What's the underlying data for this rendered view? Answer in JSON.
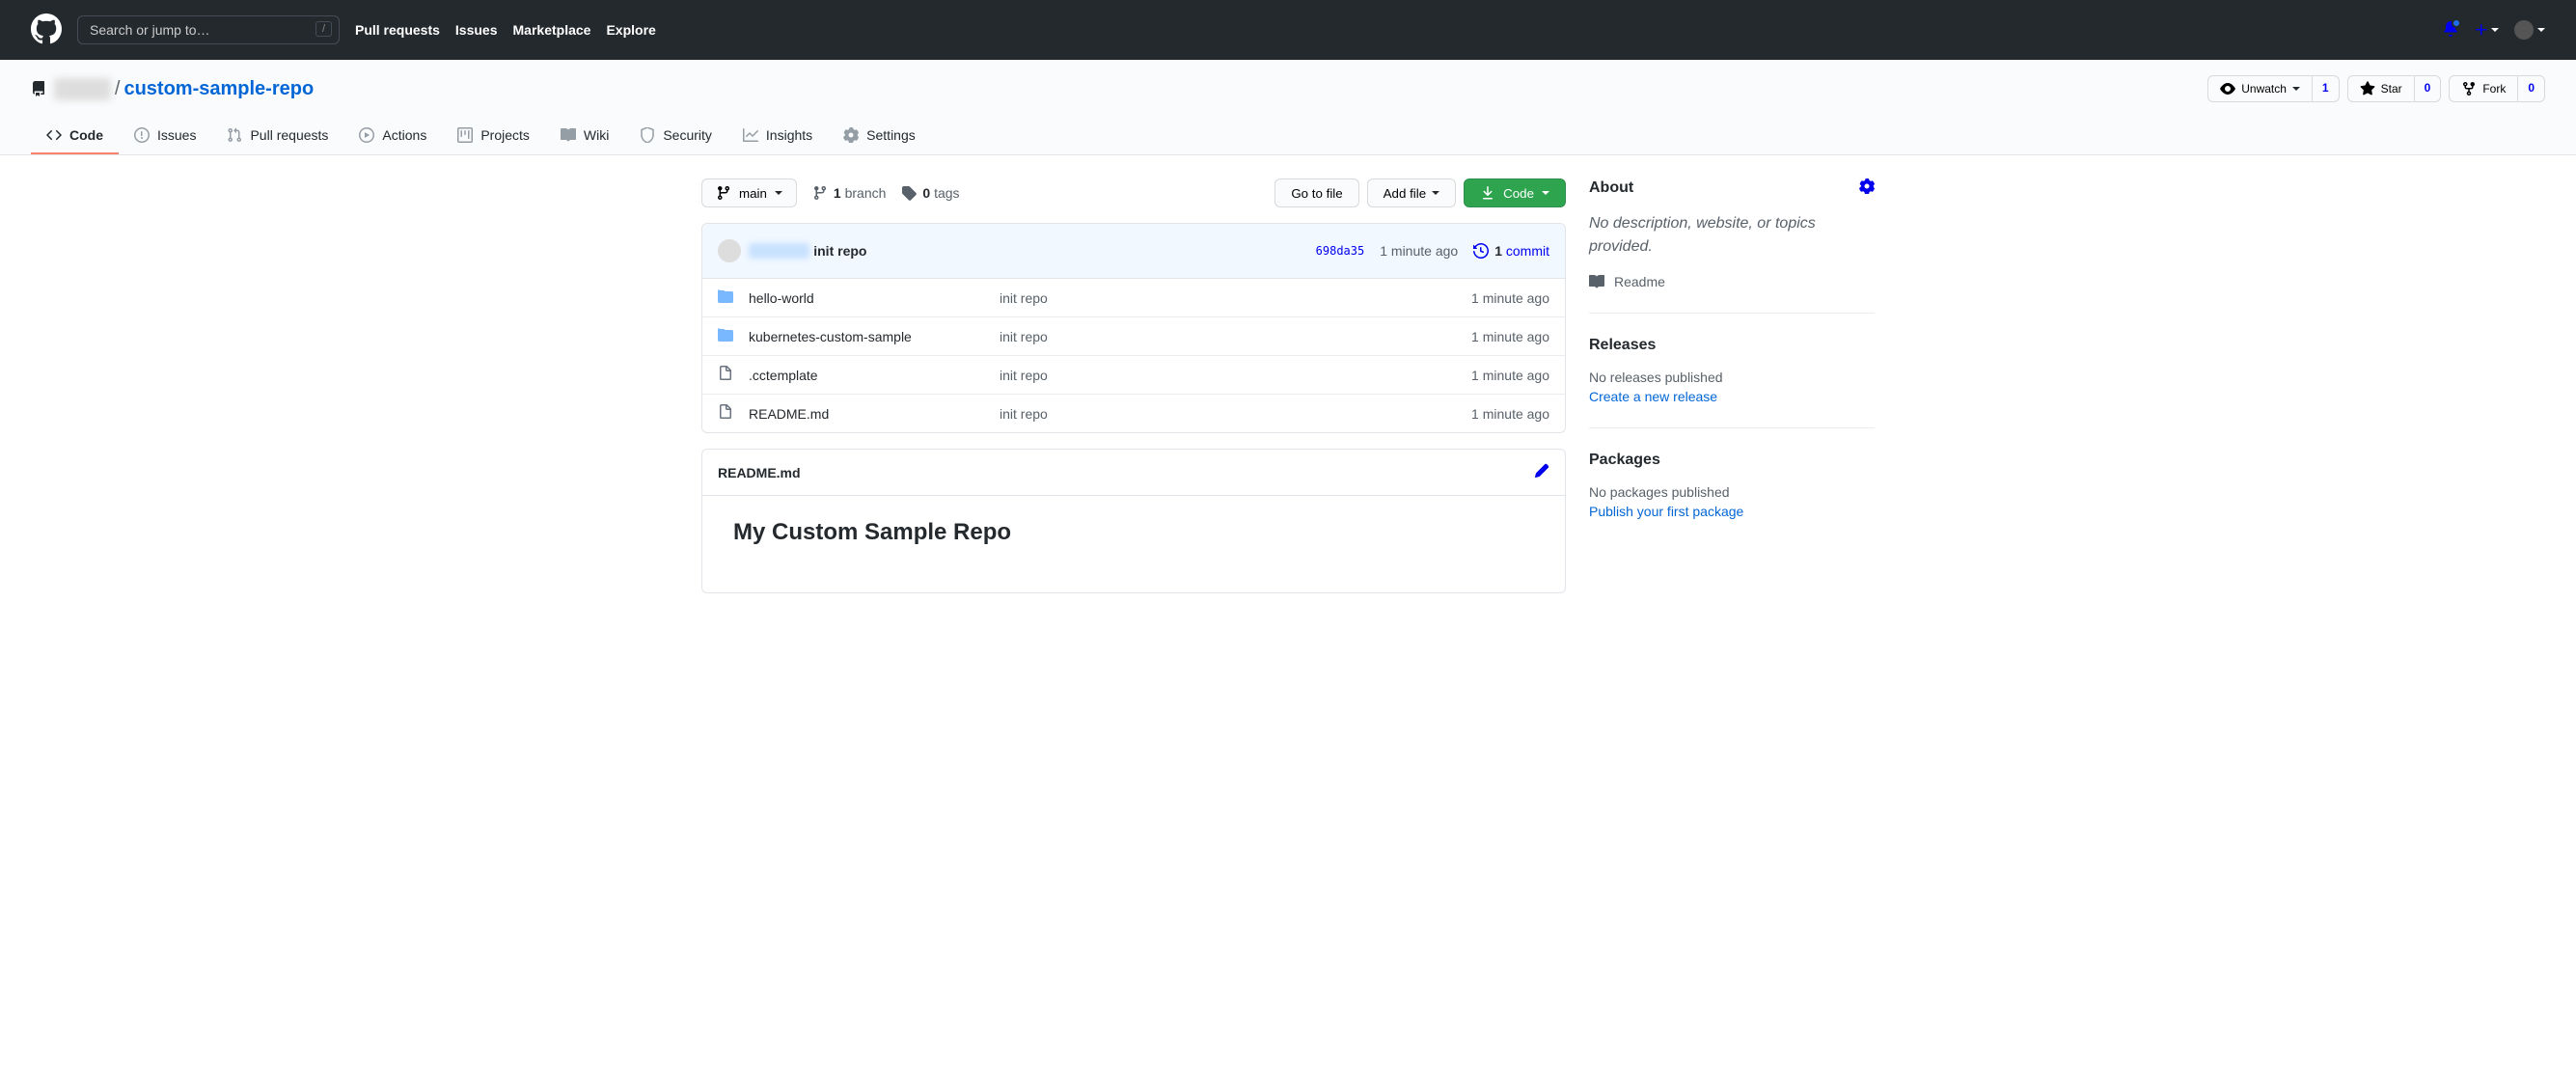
{
  "header": {
    "search_placeholder": "Search or jump to…",
    "slash_key": "/",
    "nav": {
      "pull_requests": "Pull requests",
      "issues": "Issues",
      "marketplace": "Marketplace",
      "explore": "Explore"
    }
  },
  "repo": {
    "owner": "user",
    "name": "custom-sample-repo",
    "actions": {
      "watch": {
        "label": "Unwatch",
        "count": "1"
      },
      "star": {
        "label": "Star",
        "count": "0"
      },
      "fork": {
        "label": "Fork",
        "count": "0"
      }
    }
  },
  "reponav": {
    "code": "Code",
    "issues": "Issues",
    "pulls": "Pull requests",
    "actions": "Actions",
    "projects": "Projects",
    "wiki": "Wiki",
    "security": "Security",
    "insights": "Insights",
    "settings": "Settings"
  },
  "filenav": {
    "branch": "main",
    "branch_count": "1",
    "branch_label": "branch",
    "tag_count": "0",
    "tag_label": "tags",
    "go_to_file": "Go to file",
    "add_file": "Add file",
    "code": "Code"
  },
  "commit_summary": {
    "author": "user",
    "message": "init repo",
    "sha": "698da35",
    "time": "1 minute ago",
    "commit_count": "1",
    "commit_label": "commit"
  },
  "files": [
    {
      "type": "dir",
      "name": "hello-world",
      "msg": "init repo",
      "age": "1 minute ago"
    },
    {
      "type": "dir",
      "name": "kubernetes-custom-sample",
      "msg": "init repo",
      "age": "1 minute ago"
    },
    {
      "type": "file",
      "name": ".cctemplate",
      "msg": "init repo",
      "age": "1 minute ago"
    },
    {
      "type": "file",
      "name": "README.md",
      "msg": "init repo",
      "age": "1 minute ago"
    }
  ],
  "readme": {
    "filename": "README.md",
    "heading": "My Custom Sample Repo"
  },
  "sidebar": {
    "about": {
      "title": "About",
      "description": "No description, website, or topics provided.",
      "readme": "Readme"
    },
    "releases": {
      "title": "Releases",
      "none": "No releases published",
      "create": "Create a new release"
    },
    "packages": {
      "title": "Packages",
      "none": "No packages published",
      "publish": "Publish your first package"
    }
  }
}
